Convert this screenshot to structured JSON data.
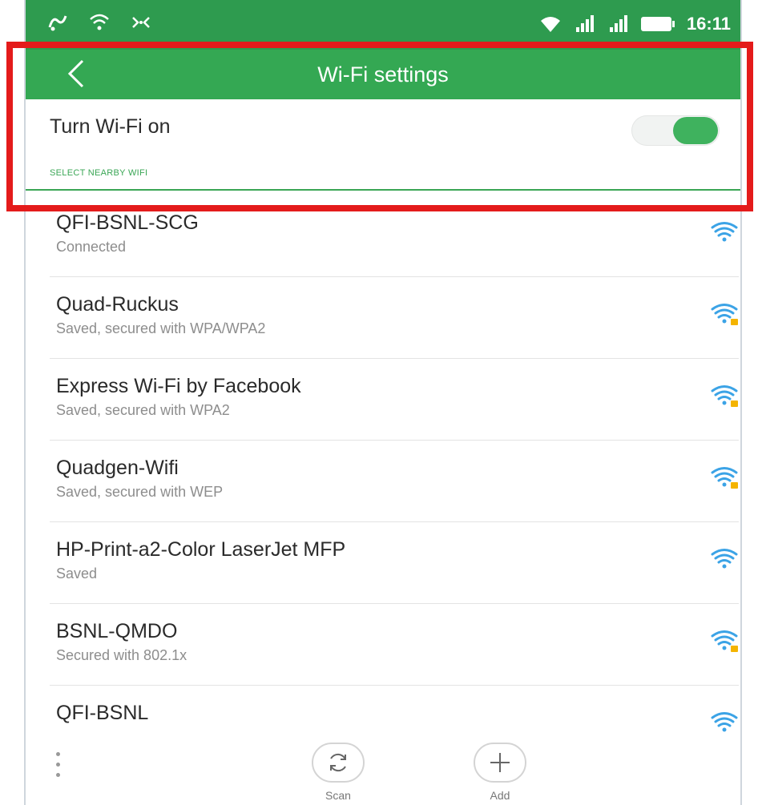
{
  "status_bar": {
    "time": "16:11",
    "icons": [
      "app-notification-icon",
      "wifi-hotspot-icon",
      "screen-cast-icon",
      "wifi-signal-icon",
      "cellular-signal-icon",
      "battery-icon"
    ]
  },
  "header": {
    "title": "Wi-Fi settings",
    "back_icon": "chevron-left-icon"
  },
  "toggle": {
    "label": "Turn Wi-Fi on",
    "state": "on"
  },
  "section": {
    "header": "SELECT NEARBY WIFI"
  },
  "networks": [
    {
      "name": "QFI-BSNL-SCG",
      "status": "Connected",
      "locked": false
    },
    {
      "name": "Quad-Ruckus",
      "status": "Saved, secured with WPA/WPA2",
      "locked": true
    },
    {
      "name": "Express Wi-Fi by Facebook",
      "status": "Saved, secured with WPA2",
      "locked": true
    },
    {
      "name": "Quadgen-Wifi",
      "status": "Saved, secured with WEP",
      "locked": true
    },
    {
      "name": "HP-Print-a2-Color LaserJet MFP",
      "status": "Saved",
      "locked": false
    },
    {
      "name": "BSNL-QMDO",
      "status": "Secured with 802.1x",
      "locked": true
    },
    {
      "name": "QFI-BSNL",
      "status": "",
      "locked": false
    }
  ],
  "toolbar": {
    "scan_label": "Scan",
    "add_label": "Add"
  },
  "colors": {
    "status_bar": "#2e9b4f",
    "app_bar": "#34a853",
    "accent": "#3aa655",
    "wifi_icon": "#3ba3e6",
    "lock_badge": "#f4b400",
    "highlight": "#e41b1b"
  }
}
